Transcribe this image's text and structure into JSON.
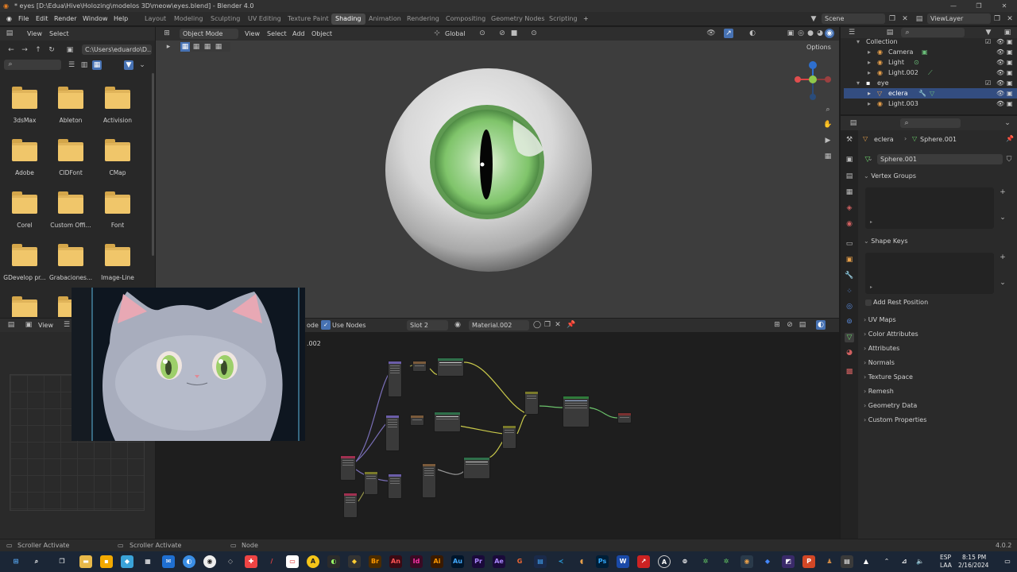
{
  "window": {
    "title": "* eyes [D:\\Edua\\Hive\\Holozing\\modelos 3D\\meow\\eyes.blend] - Blender 4.0",
    "controls": [
      "—",
      "❐",
      "✕"
    ]
  },
  "menu": [
    "File",
    "Edit",
    "Render",
    "Window",
    "Help"
  ],
  "workspaces": [
    "Layout",
    "Modeling",
    "Sculpting",
    "UV Editing",
    "Texture Paint",
    "Shading",
    "Animation",
    "Rendering",
    "Compositing",
    "Geometry Nodes",
    "Scripting"
  ],
  "active_workspace": "Shading",
  "scene": {
    "label": "Scene",
    "view_layer": "ViewLayer"
  },
  "file_browser": {
    "header": {
      "view": "View",
      "select": "Select"
    },
    "path": "C:\\Users\\eduardo\\D...",
    "folders": [
      "3dsMax",
      "Ableton",
      "Activision",
      "Adobe",
      "CIDFont",
      "CMap",
      "Corel",
      "Custom Offi...",
      "Font",
      "GDevelop pr...",
      "Grabaciones...",
      "Image-Line"
    ]
  },
  "image_editor": {
    "view": "View"
  },
  "viewport": {
    "mode": "Object Mode",
    "menu": [
      "View",
      "Select",
      "Add",
      "Object"
    ],
    "orientation": "Global",
    "options": "Options"
  },
  "node_editor": {
    "mode_partial": "ode",
    "use_nodes": "Use Nodes",
    "slot": "Slot 2",
    "material": "Material.002",
    "material_partial": ".002"
  },
  "outliner": {
    "rows": [
      {
        "label": "Collection",
        "indent": 0
      },
      {
        "label": "Camera",
        "indent": 1
      },
      {
        "label": "Light",
        "indent": 1
      },
      {
        "label": "Light.002",
        "indent": 1
      },
      {
        "label": "eye",
        "indent": 0
      },
      {
        "label": "eclera",
        "indent": 1,
        "selected": true
      },
      {
        "label": "Light.003",
        "indent": 1
      }
    ]
  },
  "properties": {
    "object": "eclera",
    "mesh": "Sphere.001",
    "mesh_field": "Sphere.001",
    "sections": [
      "Vertex Groups",
      "Shape Keys",
      "Add Rest Position",
      "UV Maps",
      "Color Attributes",
      "Attributes",
      "Normals",
      "Texture Space",
      "Remesh",
      "Geometry Data",
      "Custom Properties"
    ]
  },
  "status_bar": {
    "left": "Scroller Activate",
    "middle": "Scroller Activate",
    "right": "Node",
    "version": "4.0.2"
  },
  "taskbar": {
    "lang": "ESP",
    "region": "LAA",
    "time": "8:15 PM",
    "date": "2/16/2024"
  },
  "colors": {
    "accent": "#4772b3",
    "selection": "#334d80",
    "iris": "#7fc46a",
    "folder": "#e8bc5e"
  }
}
